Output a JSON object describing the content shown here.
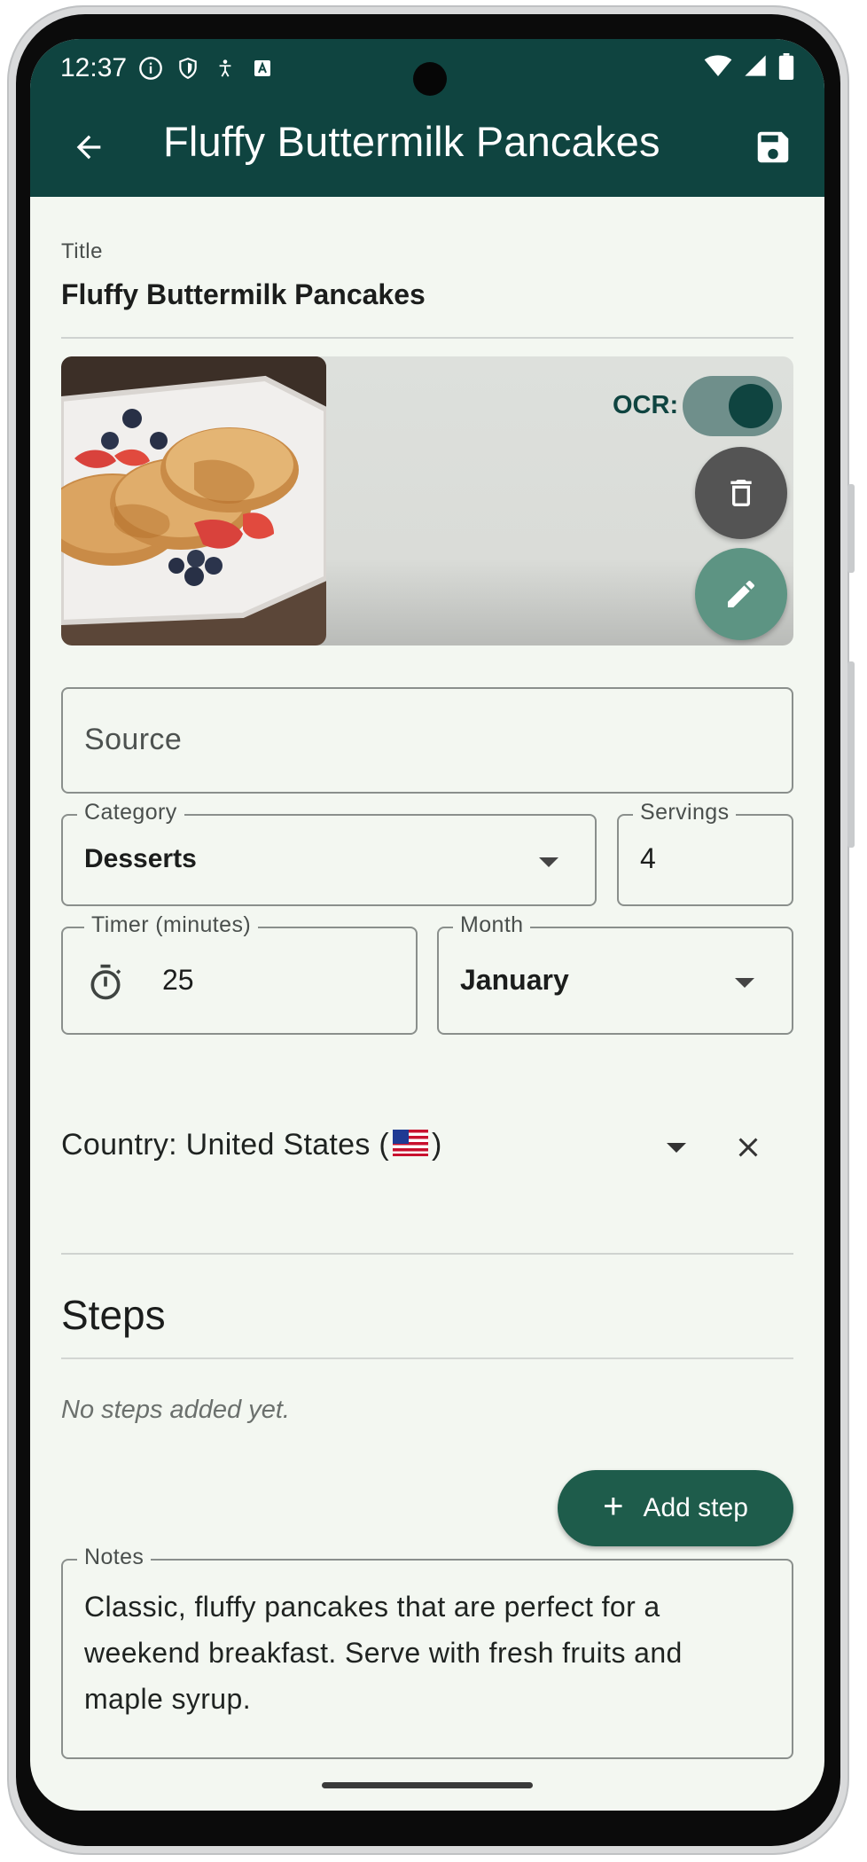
{
  "status_bar": {
    "time": "12:37"
  },
  "app_bar": {
    "title": "Fluffy Buttermilk Pancakes"
  },
  "title_field": {
    "label": "Title",
    "value": "Fluffy Buttermilk Pancakes"
  },
  "image_card": {
    "ocr_label": "OCR:",
    "ocr_enabled": true
  },
  "source_field": {
    "placeholder": "Source"
  },
  "category_field": {
    "label": "Category",
    "value": "Desserts"
  },
  "servings_field": {
    "label": "Servings",
    "value": "4"
  },
  "timer_field": {
    "label": "Timer (minutes)",
    "value": "25"
  },
  "month_field": {
    "label": "Month",
    "value": "January"
  },
  "country": {
    "prefix": "Country: United States (",
    "suffix": ")"
  },
  "steps": {
    "heading": "Steps",
    "empty_text": "No steps added yet.",
    "add_label": "Add step"
  },
  "notes_field": {
    "label": "Notes",
    "value": "Classic, fluffy pancakes that are perfect for a weekend breakfast. Serve with fresh fruits and maple syrup."
  },
  "colors": {
    "primary": "#0f4440",
    "accent": "#1e5c4b",
    "background": "#f3f7f1"
  }
}
